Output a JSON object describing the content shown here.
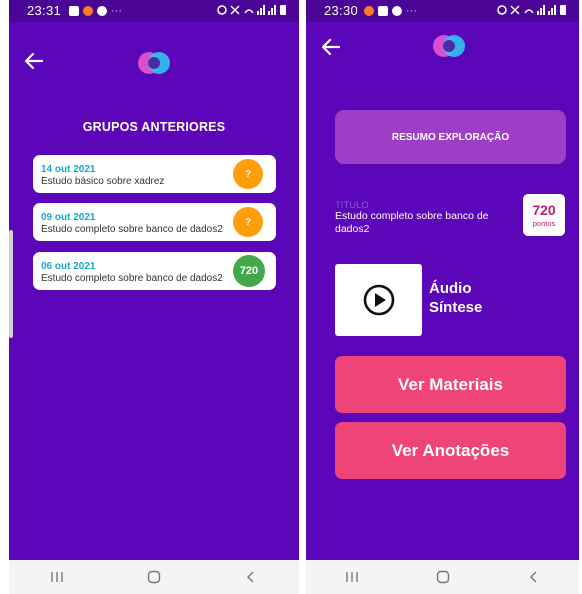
{
  "colors": {
    "background": "#5b06b8",
    "statusbar": "#4a0596",
    "accent_cyan": "#18a7c9",
    "badge_orange": "#ff9d0c",
    "badge_green": "#43a84a",
    "button_pink": "#ef4478",
    "resumo_purple": "#9d3fc6",
    "score_pink": "#c8196a"
  },
  "left": {
    "status_time": "23:31",
    "status_dots": "···",
    "title": "GRUPOS ANTERIORES",
    "groups": [
      {
        "date": "14 out 2021",
        "name": "Estudo básico sobre xadrez",
        "badge": "?",
        "badge_color": "orange"
      },
      {
        "date": "09 out 2021",
        "name": "Estudo completo sobre banco de dados2",
        "badge": "?",
        "badge_color": "orange"
      },
      {
        "date": "06 out 2021",
        "name": "Estudo completo sobre banco de dados2",
        "badge": "720",
        "badge_color": "green"
      }
    ]
  },
  "right": {
    "status_time": "23:30",
    "status_dots": "···",
    "resumo_label": "RESUMO EXPLORAÇÃO",
    "titulo_label": "TITULO",
    "titulo_text": "Estudo completo sobre banco de dados2",
    "score_value": "720",
    "score_unit": "pontos",
    "audio_label_line1": "Áudio",
    "audio_label_line2": "Síntese",
    "ver_materiais": "Ver Materiais",
    "ver_anotacoes": "Ver Anotações"
  },
  "icons": [
    "back-arrow-icon",
    "app-logo-icon",
    "play-icon",
    "recents-icon",
    "home-icon",
    "nav-back-icon",
    "gallery-icon",
    "wifi-icon",
    "signal-icon",
    "battery-icon",
    "alarm-icon"
  ]
}
